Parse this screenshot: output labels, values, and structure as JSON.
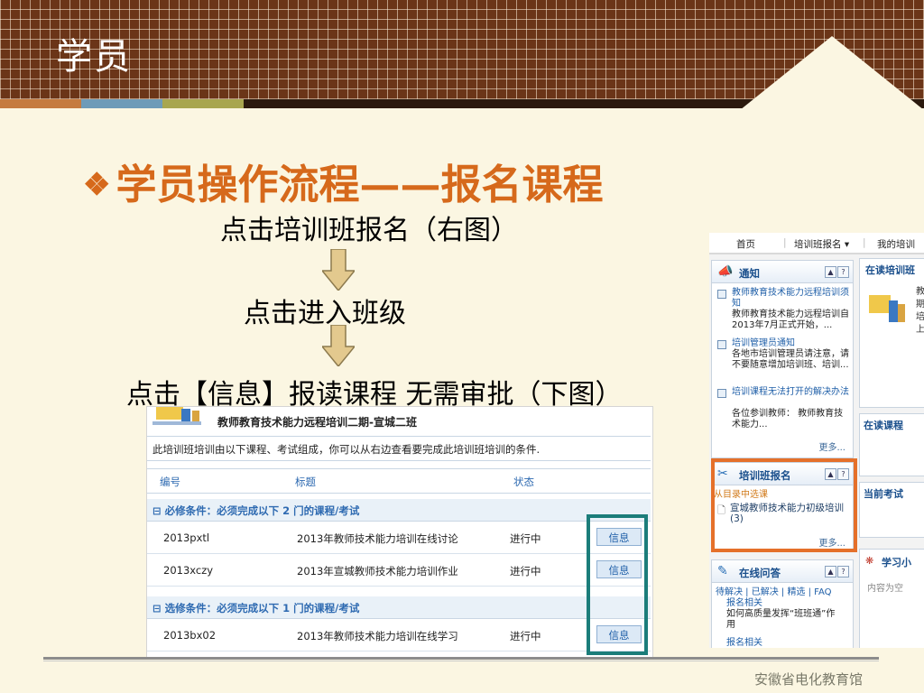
{
  "banner": {
    "title": "学员"
  },
  "colors": {
    "banner": "#6b3518",
    "heading": "#d6691b",
    "orange_highlight": "#e5702a",
    "teal_highlight": "#1b7d7a"
  },
  "heading": {
    "bullet": "❖",
    "text": "学员操作流程——报名课程"
  },
  "steps": [
    "点击培训班报名（右图）",
    "点击进入班级",
    "点击【信息】报读课程 无需审批（下图）"
  ],
  "footer": {
    "org": "安徽省电化教育馆"
  },
  "class_page": {
    "title": "教师教育技术能力远程培训二期-宣城二班",
    "description": "此培训班培训由以下课程、考试组成，你可以从右边查看要完成此培训班培训的条件.",
    "columns": [
      "编号",
      "标题",
      "状态"
    ],
    "groups": [
      {
        "label": "⊟ 必修条件：必须完成以下  2 门的课程/考试",
        "rows": [
          {
            "code": "2013pxtl",
            "title": "2013年教师技术能力培训在线讨论",
            "status": "进行中",
            "action": "信息"
          },
          {
            "code": "2013xczy",
            "title": "2013年宣城教师技术能力培训作业",
            "status": "进行中",
            "action": "信息"
          }
        ]
      },
      {
        "label": "⊟ 选修条件：必须完成以下  1 门的课程/考试",
        "rows": [
          {
            "code": "2013bx02",
            "title": "2013年教师技术能力培训在线学习",
            "status": "进行中",
            "action": "信息"
          }
        ]
      }
    ]
  },
  "portal": {
    "nav": [
      "首页",
      "培训班报名 ▾",
      "我的培训"
    ],
    "notice": {
      "title": "通知",
      "items": [
        {
          "title": "教师教育技术能力远程培训须知",
          "body": "教师教育技术能力远程培训自2013年7月正式开始，..."
        },
        {
          "title": "培训管理员通知",
          "body": "各地市培训管理员请注意，请不要随意增加培训班、培训..."
        },
        {
          "title": "培训课程无法打开的解决办法",
          "body": "各位参训教师：  教师教育技术能力..."
        }
      ],
      "more": "更多..."
    },
    "signup": {
      "title": "培训班报名",
      "subtitle": "从目录中选课",
      "item": "宣城教师技术能力初级培训 (3)",
      "more": "更多..."
    },
    "qa": {
      "title": "在线问答",
      "tabs": "待解决 | 已解决 | 精选 | FAQ",
      "items": [
        {
          "title": "报名相关",
          "body": "如何高质量发挥“班班通”作用"
        },
        {
          "title": "报名相关",
          "body": ""
        }
      ]
    },
    "side": {
      "current": "在读培训班",
      "current_lines": [
        "教",
        "期",
        "培",
        "上"
      ],
      "courses_tab": "在读课程",
      "exam_tab": "当前考试",
      "study": "学习小",
      "empty": "内容为空"
    },
    "panel_buttons": [
      "▲",
      "?"
    ]
  }
}
